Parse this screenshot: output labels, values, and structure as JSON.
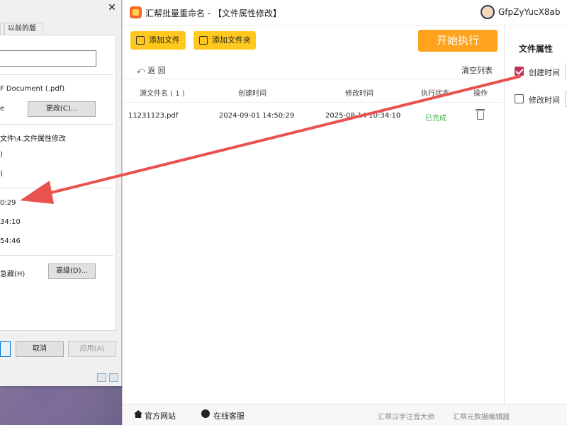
{
  "props_dialog": {
    "close_glyph": "✕",
    "tabs": [
      "li",
      "以前的版本"
    ],
    "type_text": "F Document (.pdf)",
    "opens_with_text": "e",
    "change_button": "更改(C)...",
    "location_text": "文件\\4.文件属性修改",
    "size_text": ")",
    "size_disk_text": ")",
    "created_text": "0:29",
    "modified_text": "34:10",
    "accessed_text": "54:46",
    "hidden_text": "急藏(H)",
    "advanced_button": "高级(D)...",
    "cancel_button": "取消",
    "apply_button": "应用(A)"
  },
  "app": {
    "title": "汇帮批量重命名 - 【文件属性修改】",
    "username": "GfpZyYucX8ab",
    "add_file": "添加文件",
    "add_folder": "添加文件夹",
    "start": "开始执行",
    "back": "返  回",
    "clear": "清空列表",
    "table": {
      "headers": [
        "源文件名 ( 1 )",
        "创建时间",
        "修改时间",
        "执行状态",
        "操作"
      ],
      "rows": [
        {
          "name": "11231123.pdf",
          "created": "2024-09-01 14:50:29",
          "modified": "2025-08-14 10:34:10",
          "status": "已完成"
        }
      ]
    },
    "panel": {
      "title": "文件属性",
      "created_label": "创建时间",
      "created_checked": true,
      "modified_label": "修改时间",
      "modified_checked": false
    },
    "footer": {
      "official_site": "官方网站",
      "online_service": "在线客服",
      "link1": "汇帮汉字注音大师",
      "link2": "汇帮元数据编辑器"
    }
  },
  "colors": {
    "toolbar_yellow": "#ffc81f",
    "start_orange": "#ffa21d",
    "done_green": "#3fae3f",
    "checkbox_red": "#c0345a",
    "arrow_red": "#e8534f"
  }
}
